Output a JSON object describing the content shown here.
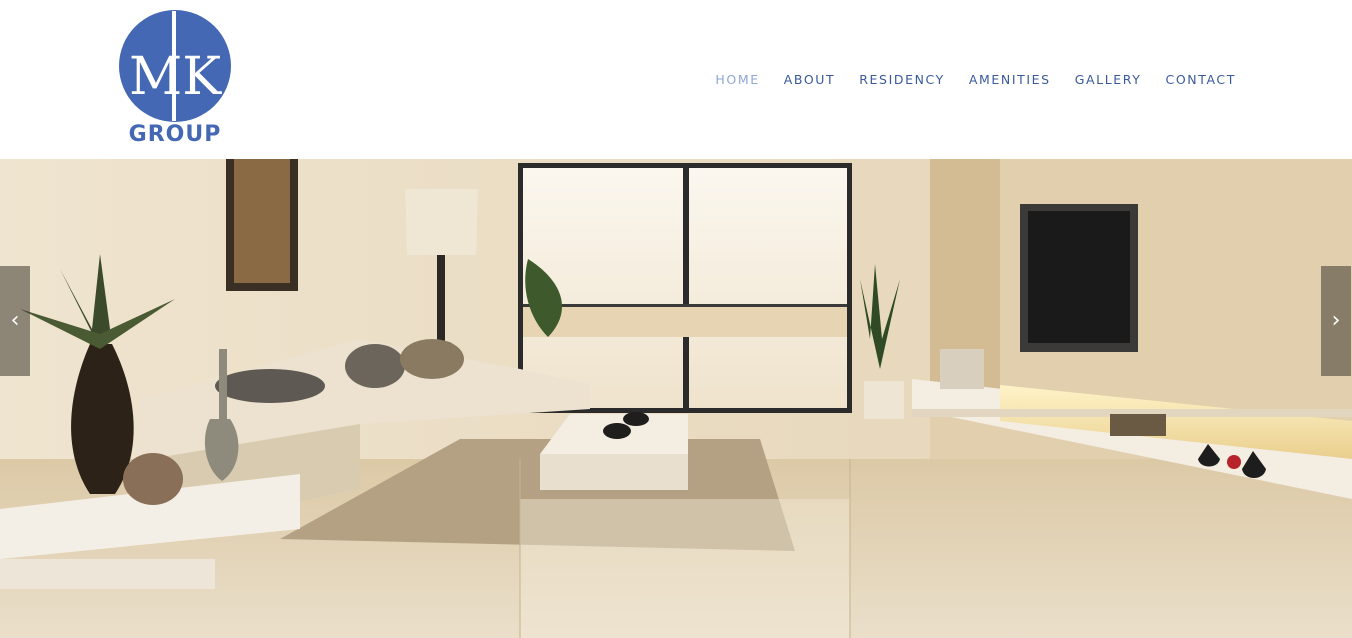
{
  "logo": {
    "monogram": "MK",
    "text": "GROUP",
    "color": "#4468b3"
  },
  "nav": {
    "items": [
      {
        "label": "HOME",
        "active": true
      },
      {
        "label": "ABOUT",
        "active": false
      },
      {
        "label": "RESIDENCY",
        "active": false
      },
      {
        "label": "AMENITIES",
        "active": false
      },
      {
        "label": "GALLERY",
        "active": false
      },
      {
        "label": "CONTACT",
        "active": false
      }
    ],
    "color": "#3a5a9c",
    "active_color": "#8fa6d6"
  },
  "slider": {
    "prev_icon": "chevron-left-icon",
    "next_icon": "chevron-right-icon",
    "prev_glyph": "‹",
    "next_glyph": "›",
    "image_subject": "living-room-interior"
  }
}
